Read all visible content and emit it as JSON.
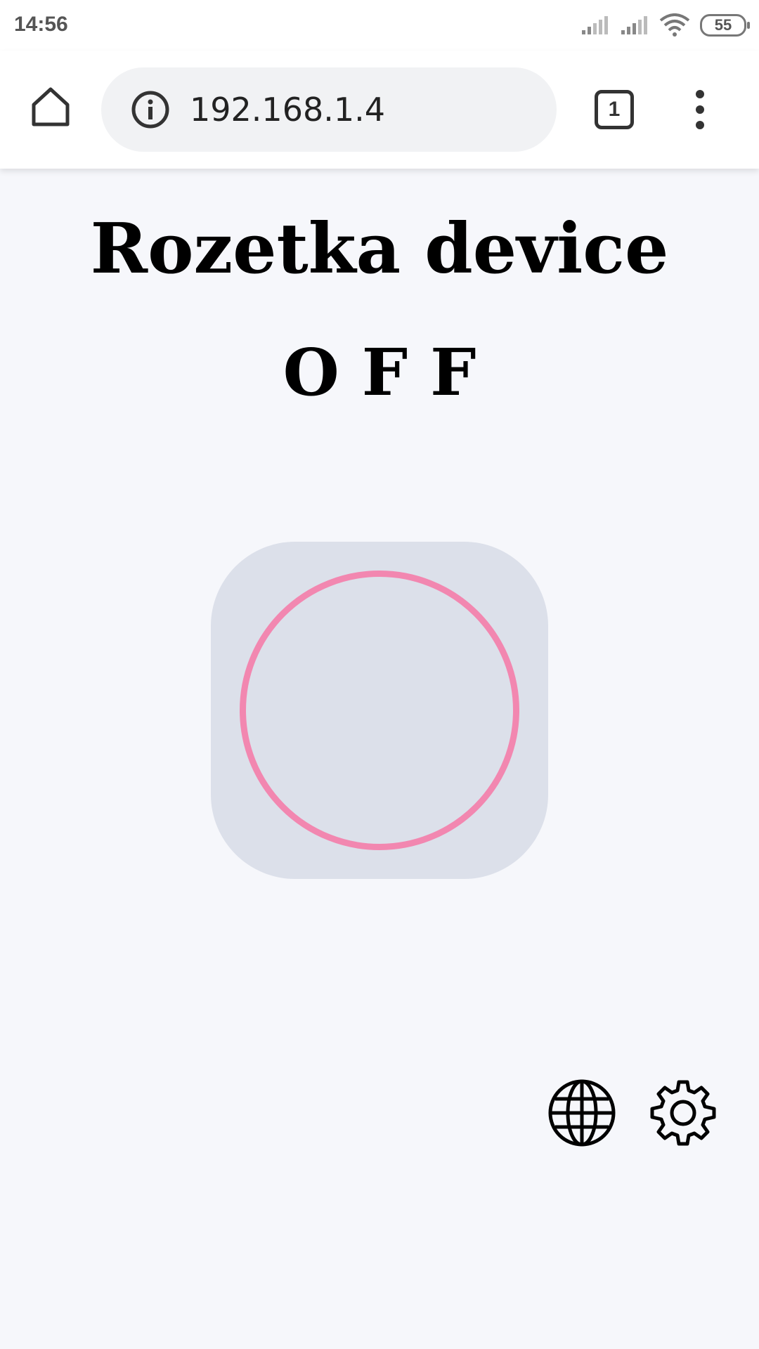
{
  "status_bar": {
    "time": "14:56",
    "battery": "55",
    "icons": [
      "signal-icon",
      "signal-icon",
      "wifi-icon",
      "battery-icon"
    ]
  },
  "browser": {
    "url": "192.168.1.4",
    "tab_count": "1",
    "icons": [
      "home-icon",
      "info-icon",
      "tabs-icon",
      "more-icon"
    ]
  },
  "page": {
    "title": "Rozetka device",
    "state": "O F F",
    "ring_color": "#f287b0",
    "button_bg": "#dce0ea",
    "icons": [
      "globe-icon",
      "gear-icon"
    ]
  }
}
